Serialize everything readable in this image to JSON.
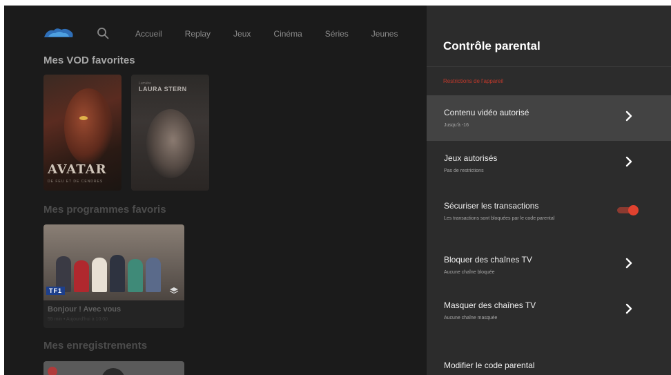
{
  "nav": {
    "items": [
      "Accueil",
      "Replay",
      "Jeux",
      "Cinéma",
      "Séries",
      "Jeunes"
    ]
  },
  "sections": {
    "vod_title": "Mes VOD favorites",
    "programs_title": "Mes programmes favoris",
    "recordings_title": "Mes enregistrements"
  },
  "posters": [
    {
      "title": "AVATAR",
      "subtitle": "DE FEU ET DE CENDRES"
    },
    {
      "kicker": "Lumière",
      "title": "LAURA STERN"
    }
  ],
  "program_card": {
    "channel": "TF1",
    "title": "Bonjour ! Avec vous",
    "meta": "55 min • Aujourd'hui à 10:00"
  },
  "panel": {
    "title": "Contrôle parental",
    "section_label": "Restrictions de l'appareil",
    "items": [
      {
        "title": "Contenu vidéo autorisé",
        "subtitle": "Jusqu'à -16",
        "control": "chevron",
        "focused": true
      },
      {
        "title": "Jeux autorisés",
        "subtitle": "Pas de restrictions",
        "control": "chevron"
      },
      {
        "title": "Sécuriser les transactions",
        "subtitle": "Les transactions sont bloquées par le code parental",
        "control": "toggle",
        "toggle_on": true
      },
      {
        "title": "Bloquer des chaînes TV",
        "subtitle": "Aucune chaîne bloquée",
        "control": "chevron"
      },
      {
        "title": "Masquer des chaînes TV",
        "subtitle": "Aucune chaîne masquée",
        "control": "chevron"
      },
      {
        "title": "Modifier le code parental"
      }
    ]
  },
  "colors": {
    "accent": "#e0422f",
    "section_label": "#c0392b",
    "panel_bg": "#2c2c2c",
    "focused_bg": "#434343"
  }
}
